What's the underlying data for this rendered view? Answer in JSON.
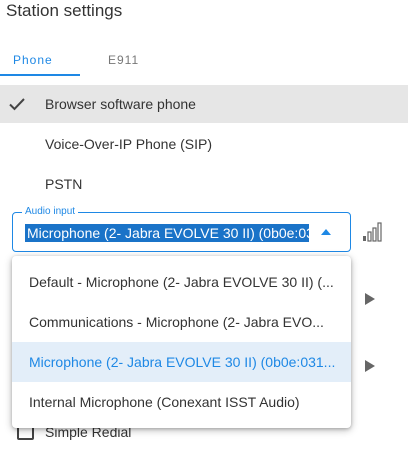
{
  "header": {
    "title": "Station settings"
  },
  "tabs": [
    {
      "label": "Phone",
      "active": true
    },
    {
      "label": "E911",
      "active": false
    }
  ],
  "phone_options": [
    {
      "label": "Browser software phone",
      "selected": true
    },
    {
      "label": "Voice-Over-IP Phone (SIP)",
      "selected": false
    },
    {
      "label": "PSTN",
      "selected": false
    }
  ],
  "audio_input": {
    "legend": "Audio input",
    "value": "Microphone (2- Jabra EVOLVE 30 II) (0b0e:03"
  },
  "dropdown_options": [
    {
      "label": "Default - Microphone (2- Jabra EVOLVE 30 II) (..."
    },
    {
      "label": "Communications - Microphone (2- Jabra EVO..."
    },
    {
      "label": "Microphone (2- Jabra EVOLVE 30 II) (0b0e:031...",
      "selected": true
    },
    {
      "label": "Internal Microphone (Conexant ISST Audio)"
    }
  ],
  "simple_redial": {
    "label": "Simple Redial",
    "checked": false
  },
  "colors": {
    "accent": "#1e88e5",
    "selected_bg": "#e6e6e6",
    "dropdown_selected_bg": "#e3eef9"
  },
  "icons": [
    "check-icon",
    "dropdown-arrow-icon",
    "audio-level-icon",
    "play-arrow-icon"
  ]
}
